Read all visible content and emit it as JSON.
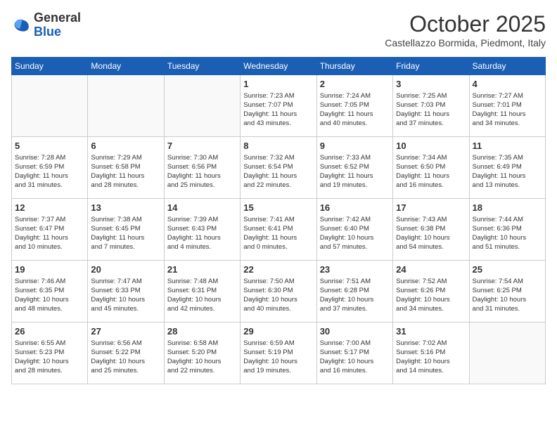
{
  "header": {
    "logo": {
      "line1": "General",
      "line2": "Blue"
    },
    "month": "October 2025",
    "location": "Castellazzo Bormida, Piedmont, Italy"
  },
  "days_of_week": [
    "Sunday",
    "Monday",
    "Tuesday",
    "Wednesday",
    "Thursday",
    "Friday",
    "Saturday"
  ],
  "weeks": [
    [
      {
        "day": "",
        "info": ""
      },
      {
        "day": "",
        "info": ""
      },
      {
        "day": "",
        "info": ""
      },
      {
        "day": "1",
        "info": "Sunrise: 7:23 AM\nSunset: 7:07 PM\nDaylight: 11 hours\nand 43 minutes."
      },
      {
        "day": "2",
        "info": "Sunrise: 7:24 AM\nSunset: 7:05 PM\nDaylight: 11 hours\nand 40 minutes."
      },
      {
        "day": "3",
        "info": "Sunrise: 7:25 AM\nSunset: 7:03 PM\nDaylight: 11 hours\nand 37 minutes."
      },
      {
        "day": "4",
        "info": "Sunrise: 7:27 AM\nSunset: 7:01 PM\nDaylight: 11 hours\nand 34 minutes."
      }
    ],
    [
      {
        "day": "5",
        "info": "Sunrise: 7:28 AM\nSunset: 6:59 PM\nDaylight: 11 hours\nand 31 minutes."
      },
      {
        "day": "6",
        "info": "Sunrise: 7:29 AM\nSunset: 6:58 PM\nDaylight: 11 hours\nand 28 minutes."
      },
      {
        "day": "7",
        "info": "Sunrise: 7:30 AM\nSunset: 6:56 PM\nDaylight: 11 hours\nand 25 minutes."
      },
      {
        "day": "8",
        "info": "Sunrise: 7:32 AM\nSunset: 6:54 PM\nDaylight: 11 hours\nand 22 minutes."
      },
      {
        "day": "9",
        "info": "Sunrise: 7:33 AM\nSunset: 6:52 PM\nDaylight: 11 hours\nand 19 minutes."
      },
      {
        "day": "10",
        "info": "Sunrise: 7:34 AM\nSunset: 6:50 PM\nDaylight: 11 hours\nand 16 minutes."
      },
      {
        "day": "11",
        "info": "Sunrise: 7:35 AM\nSunset: 6:49 PM\nDaylight: 11 hours\nand 13 minutes."
      }
    ],
    [
      {
        "day": "12",
        "info": "Sunrise: 7:37 AM\nSunset: 6:47 PM\nDaylight: 11 hours\nand 10 minutes."
      },
      {
        "day": "13",
        "info": "Sunrise: 7:38 AM\nSunset: 6:45 PM\nDaylight: 11 hours\nand 7 minutes."
      },
      {
        "day": "14",
        "info": "Sunrise: 7:39 AM\nSunset: 6:43 PM\nDaylight: 11 hours\nand 4 minutes."
      },
      {
        "day": "15",
        "info": "Sunrise: 7:41 AM\nSunset: 6:41 PM\nDaylight: 11 hours\nand 0 minutes."
      },
      {
        "day": "16",
        "info": "Sunrise: 7:42 AM\nSunset: 6:40 PM\nDaylight: 10 hours\nand 57 minutes."
      },
      {
        "day": "17",
        "info": "Sunrise: 7:43 AM\nSunset: 6:38 PM\nDaylight: 10 hours\nand 54 minutes."
      },
      {
        "day": "18",
        "info": "Sunrise: 7:44 AM\nSunset: 6:36 PM\nDaylight: 10 hours\nand 51 minutes."
      }
    ],
    [
      {
        "day": "19",
        "info": "Sunrise: 7:46 AM\nSunset: 6:35 PM\nDaylight: 10 hours\nand 48 minutes."
      },
      {
        "day": "20",
        "info": "Sunrise: 7:47 AM\nSunset: 6:33 PM\nDaylight: 10 hours\nand 45 minutes."
      },
      {
        "day": "21",
        "info": "Sunrise: 7:48 AM\nSunset: 6:31 PM\nDaylight: 10 hours\nand 42 minutes."
      },
      {
        "day": "22",
        "info": "Sunrise: 7:50 AM\nSunset: 6:30 PM\nDaylight: 10 hours\nand 40 minutes."
      },
      {
        "day": "23",
        "info": "Sunrise: 7:51 AM\nSunset: 6:28 PM\nDaylight: 10 hours\nand 37 minutes."
      },
      {
        "day": "24",
        "info": "Sunrise: 7:52 AM\nSunset: 6:26 PM\nDaylight: 10 hours\nand 34 minutes."
      },
      {
        "day": "25",
        "info": "Sunrise: 7:54 AM\nSunset: 6:25 PM\nDaylight: 10 hours\nand 31 minutes."
      }
    ],
    [
      {
        "day": "26",
        "info": "Sunrise: 6:55 AM\nSunset: 5:23 PM\nDaylight: 10 hours\nand 28 minutes."
      },
      {
        "day": "27",
        "info": "Sunrise: 6:56 AM\nSunset: 5:22 PM\nDaylight: 10 hours\nand 25 minutes."
      },
      {
        "day": "28",
        "info": "Sunrise: 6:58 AM\nSunset: 5:20 PM\nDaylight: 10 hours\nand 22 minutes."
      },
      {
        "day": "29",
        "info": "Sunrise: 6:59 AM\nSunset: 5:19 PM\nDaylight: 10 hours\nand 19 minutes."
      },
      {
        "day": "30",
        "info": "Sunrise: 7:00 AM\nSunset: 5:17 PM\nDaylight: 10 hours\nand 16 minutes."
      },
      {
        "day": "31",
        "info": "Sunrise: 7:02 AM\nSunset: 5:16 PM\nDaylight: 10 hours\nand 14 minutes."
      },
      {
        "day": "",
        "info": ""
      }
    ]
  ]
}
